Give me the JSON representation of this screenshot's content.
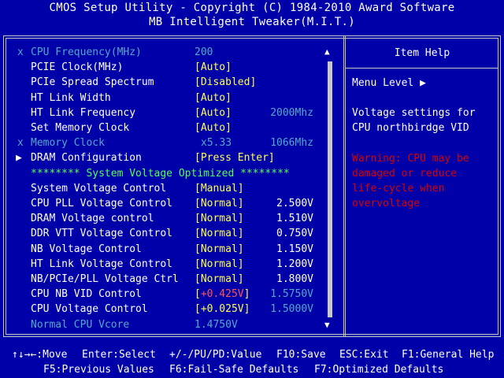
{
  "header": {
    "title": "CMOS Setup Utility - Copyright (C) 1984-2010 Award Software",
    "subtitle": "MB Intelligent Tweaker(M.I.T.)"
  },
  "settings": [
    {
      "prefix": "x",
      "label": "CPU Frequency(MHz)",
      "value": "200",
      "extra": "",
      "style": "disabled"
    },
    {
      "prefix": "",
      "label": "PCIE Clock(MHz)",
      "value": "[Auto]",
      "extra": "",
      "style": "normal"
    },
    {
      "prefix": "",
      "label": "PCIe Spread Spectrum",
      "value": "[Disabled]",
      "extra": "",
      "style": "normal"
    },
    {
      "prefix": "",
      "label": "HT Link Width",
      "value": "[Auto]",
      "extra": "",
      "style": "normal"
    },
    {
      "prefix": "",
      "label": "HT Link Frequency",
      "value": "[Auto]",
      "extra": "2000Mhz",
      "style": "normal"
    },
    {
      "prefix": "",
      "label": "Set Memory Clock",
      "value": "[Auto]",
      "extra": "",
      "style": "normal"
    },
    {
      "prefix": "x",
      "label": "Memory Clock",
      "value": "x5.33",
      "extra": "1066Mhz",
      "style": "disabled"
    },
    {
      "prefix": "▶",
      "label": "DRAM Configuration",
      "value": "[Press Enter]",
      "extra": "",
      "style": "submenu"
    },
    {
      "prefix": "",
      "label": "******** System Voltage Optimized ********",
      "value": "",
      "extra": "",
      "style": "section"
    },
    {
      "prefix": "",
      "label": "System Voltage Control",
      "value": "[Manual]",
      "extra": "",
      "style": "normal"
    },
    {
      "prefix": "",
      "label": "CPU PLL Voltage Control",
      "value": "[Normal]",
      "extra": "2.500V",
      "style": "normal"
    },
    {
      "prefix": "",
      "label": "DRAM Voltage control",
      "value": "[Normal]",
      "extra": "1.510V",
      "style": "normal"
    },
    {
      "prefix": "",
      "label": "DDR VTT Voltage Control",
      "value": "[Normal]",
      "extra": "0.750V",
      "style": "normal"
    },
    {
      "prefix": "",
      "label": "NB Voltage Control",
      "value": "[Normal]",
      "extra": "1.150V",
      "style": "normal"
    },
    {
      "prefix": "",
      "label": "HT Link Voltage Control",
      "value": "[Normal]",
      "extra": "1.200V",
      "style": "normal"
    },
    {
      "prefix": "",
      "label": "NB/PCIe/PLL Voltage Ctrl",
      "value": "[Normal]",
      "extra": "1.800V",
      "style": "normal"
    },
    {
      "prefix": "",
      "label": "CPU NB VID Control",
      "value": "[+0.425V]",
      "extra": "1.5750V",
      "style": "warn"
    },
    {
      "prefix": "",
      "label": "CPU Voltage Control",
      "value": "[+0.025V]",
      "extra": "1.5000V",
      "style": "mild"
    },
    {
      "prefix": "",
      "label": "Normal CPU Vcore",
      "value": "1.4750V",
      "extra": "",
      "style": "info"
    }
  ],
  "help": {
    "title": "Item Help",
    "menu_level": "Menu Level  ▶",
    "description": [
      "Voltage settings for",
      "CPU northbirdge VID"
    ],
    "warning": [
      "Warning: CPU may be",
      "damaged or reduce",
      "life-cycle when",
      "overvoltage"
    ]
  },
  "scrollbar": {
    "up_icon": "▲",
    "down_icon": "▼"
  },
  "footer": {
    "line1": [
      "↑↓→←:Move",
      "Enter:Select",
      "+/-/PU/PD:Value",
      "F10:Save",
      "ESC:Exit",
      "F1:General Help"
    ],
    "line2": [
      "F5:Previous Values",
      "F6:Fail-Safe Defaults",
      "F7:Optimized Defaults"
    ]
  },
  "colors": {
    "background": "#0000a8",
    "text": "#ffffff",
    "value": "#ffff55",
    "disabled": "#55a8c8",
    "section": "#55ff55",
    "warning": "#d80000",
    "alert_value": "#ff5555"
  }
}
